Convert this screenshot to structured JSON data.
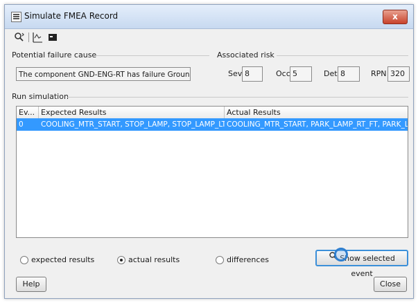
{
  "window": {
    "title": "Simulate FMEA Record",
    "close_label": "x"
  },
  "toolbar": {
    "icons": [
      "search-icon",
      "filter-icon",
      "console-icon"
    ]
  },
  "failure_cause": {
    "label": "Potential failure cause",
    "value": "The component GND-ENG-RT has failure Ground Lift."
  },
  "risk": {
    "label": "Associated risk",
    "sev_label": "Sev",
    "sev_value": "8",
    "occ_label": "Occ",
    "occ_value": "5",
    "det_label": "Det",
    "det_value": "8",
    "rpn_label": "RPN",
    "rpn_value": "320"
  },
  "simulation": {
    "label": "Run simulation",
    "columns": [
      "Ev...",
      "Expected Results",
      "Actual Results"
    ],
    "rows": [
      {
        "event": "0",
        "expected": "COOLING_MTR_START, STOP_LAMP, STOP_LAMP_LT, S...",
        "actual": "COOLING_MTR_START, PARK_LAMP_RT_FT, PARK_LAM..."
      }
    ]
  },
  "options": {
    "expected_label": "expected results",
    "actual_label": "actual results",
    "differences_label": "differences",
    "selected": "actual results"
  },
  "buttons": {
    "show_selected": "Show selected event",
    "help": "Help",
    "close": "Close"
  },
  "colors": {
    "selection": "#3399ff",
    "title_bar": "#c7d9f0",
    "close_button": "#c8432c"
  }
}
